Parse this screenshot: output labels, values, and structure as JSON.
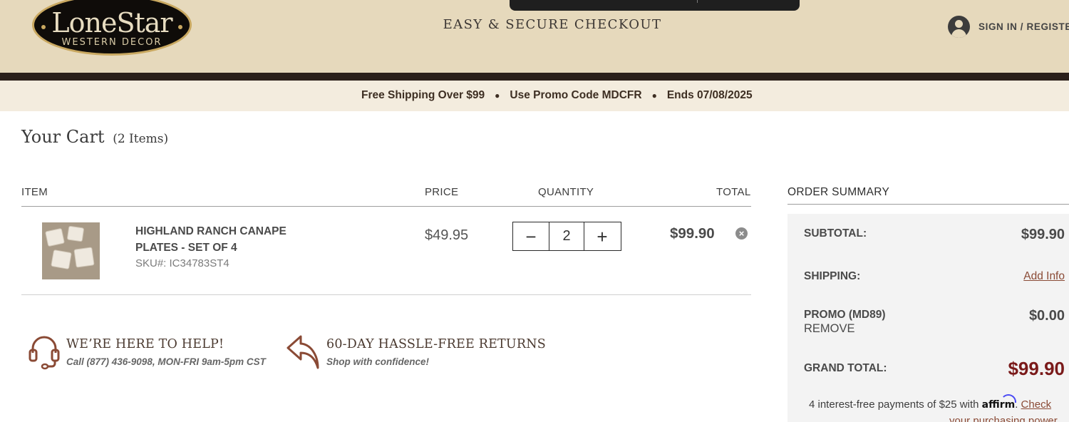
{
  "header": {
    "logo_main": "LoneStar",
    "logo_sub": "WESTERN DECOR",
    "checkout_title": "EASY & SECURE CHECKOUT",
    "signin_label": "SIGN IN / REGISTE"
  },
  "promo_bar": {
    "items": [
      "Free Shipping Over $99",
      "Use Promo Code MDCFR",
      "Ends 07/08/2025"
    ],
    "separator": "●"
  },
  "cart": {
    "title": "Your Cart",
    "count": "(2 Items)",
    "columns": {
      "item": "ITEM",
      "price": "PRICE",
      "quantity": "QUANTITY",
      "total": "TOTAL"
    },
    "items": [
      {
        "name": "HIGHLAND RANCH CANAPE PLATES - SET OF 4",
        "sku": "SKU#: IC34783ST4",
        "price": "$49.95",
        "quantity": "2",
        "total": "$99.90"
      }
    ],
    "qty_minus": "−",
    "qty_plus": "+",
    "remove_symbol": "×"
  },
  "help": {
    "title": "WE’RE HERE TO HELP!",
    "subtitle": "Call (877) 436-9098, MON-FRI 9am-5pm CST",
    "icon": "headset-icon"
  },
  "returns": {
    "title": "60-DAY HASSLE-FREE RETURNS",
    "subtitle": "Shop with confidence!",
    "icon": "return-arrow-icon"
  },
  "summary": {
    "title": "ORDER SUMMARY",
    "subtotal_label": "SUBTOTAL:",
    "subtotal_value": "$99.90",
    "shipping_label": "SHIPPING:",
    "shipping_link": "Add Info",
    "promo_label": "PROMO (MD89)",
    "promo_remove": "REMOVE",
    "promo_value": "$0.00",
    "grand_label": "GRAND TOTAL:",
    "grand_value": "$99.90",
    "affirm_text": "4 interest-free payments of $25 with",
    "affirm_logo": "affirm",
    "affirm_check": "Check",
    "affirm_line2": "your purchasing power"
  },
  "colors": {
    "header_bg": "#e6d9bc",
    "header_rule": "#2b201a",
    "promo_bg": "#f3ecde",
    "accent_brown": "#8a4a35",
    "grand_total_red": "#7a1a1a",
    "summary_bg": "#f3f3f3"
  }
}
